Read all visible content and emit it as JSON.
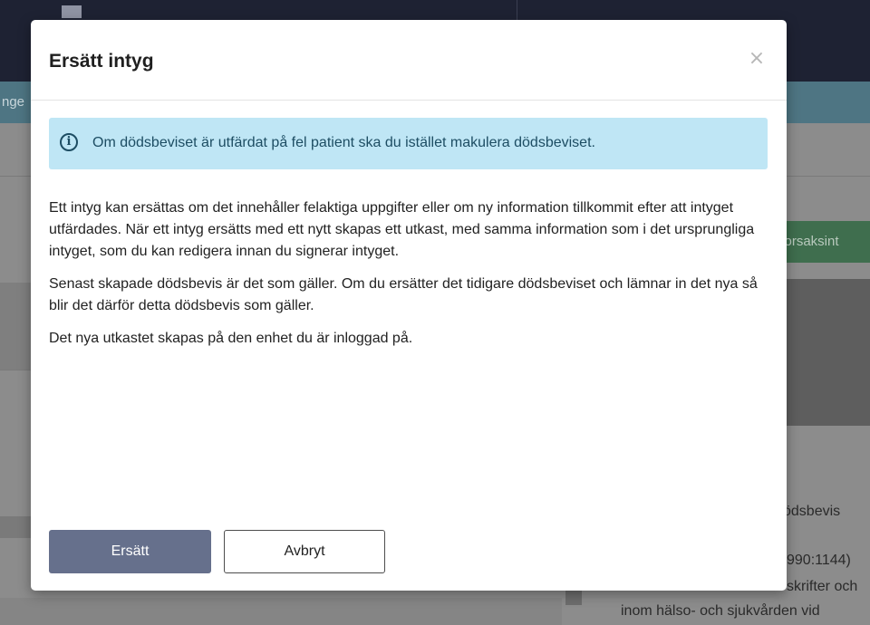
{
  "background": {
    "subbar_text": "nge",
    "green_button_label": "sorsaksint",
    "text_lines": [
      "ödsbevis",
      "990:1144)",
      "skrifter och",
      "inom hälso- och sjukvården vid"
    ]
  },
  "modal": {
    "title": "Ersätt intyg",
    "close_label": "×",
    "info_icon": "i",
    "info_text": "Om dödsbeviset är utfärdat på fel patient ska du istället makulera dödsbeviset.",
    "paragraphs": [
      "Ett intyg kan ersättas om det innehåller felaktiga uppgifter eller om ny information tillkommit efter att intyget utfärdades. När ett intyg ersätts med ett nytt skapas ett utkast, med samma information som i det ursprungliga intyget, som du kan redigera innan du signerar intyget.",
      "Senast skapade dödsbevis är det som gäller. Om du ersätter det tidigare dödsbeviset och lämnar in det nya så blir det därför detta dödsbevis som gäller.",
      "Det nya utkastet skapas på den enhet du är inloggad på."
    ],
    "primary_button": "Ersätt",
    "secondary_button": "Avbryt"
  }
}
